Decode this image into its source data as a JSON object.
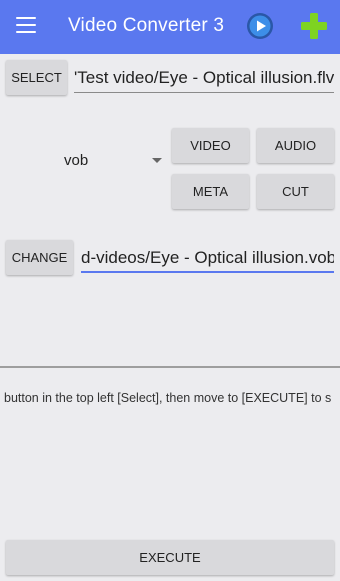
{
  "appbar": {
    "title": "Video Converter 3",
    "menu_icon": "menu-icon",
    "play_icon": "play-circle-icon",
    "add_icon": "plus-icon",
    "color": "#5a78ef"
  },
  "input": {
    "select_label": "SELECT",
    "path": "'Test video/Eye - Optical illusion.flv"
  },
  "format": {
    "selected": "vob"
  },
  "options": {
    "video_label": "VIDEO",
    "audio_label": "AUDIO",
    "meta_label": "META",
    "cut_label": "CUT"
  },
  "output": {
    "change_label": "CHANGE",
    "path": "d-videos/Eye - Optical illusion.vob"
  },
  "hint": "button in the top left [Select], then move to [EXECUTE] to s",
  "execute_label": "EXECUTE"
}
